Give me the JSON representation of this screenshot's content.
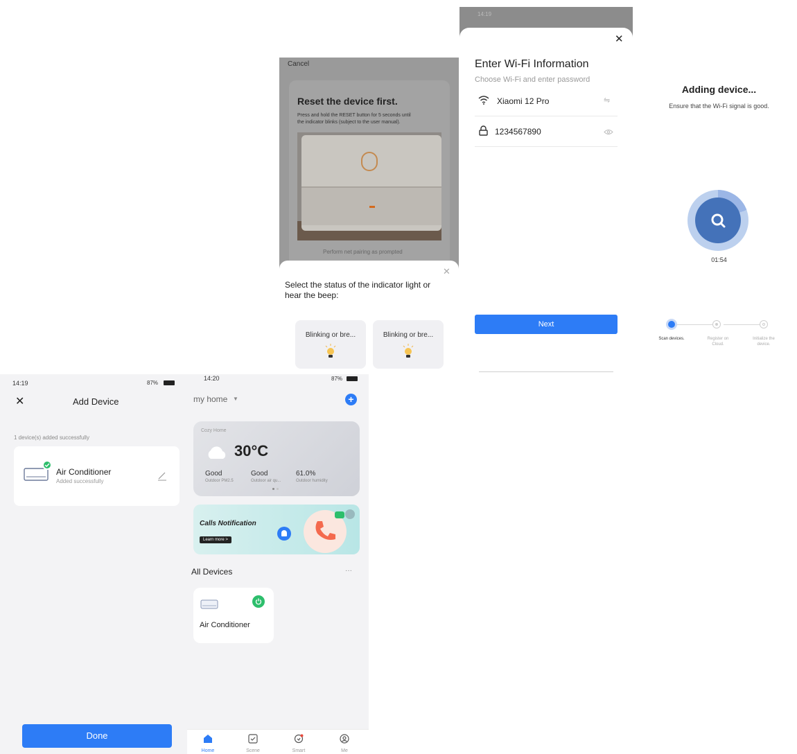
{
  "reset": {
    "cancel": "Cancel",
    "title": "Reset the device first.",
    "desc1": "Press and hold the RESET button for 5 seconds until",
    "desc2": "the indicator blinks (subject to the user manual).",
    "prompt_link": "Perform net pairing as prompted",
    "sheet_title1": "Select the status of the indicator light or",
    "sheet_title2": "hear the beep:",
    "options": [
      "Blinking or bre...",
      "Blinking or bre..."
    ]
  },
  "wifi": {
    "status_time": "14:19",
    "title": "Enter Wi-Fi Information",
    "subtitle": "Choose Wi-Fi and enter password",
    "ssid": "Xiaomi 12 Pro",
    "password": "1234567890",
    "next": "Next"
  },
  "adding": {
    "title": "Adding device...",
    "subtitle": "Ensure that the Wi-Fi signal is good.",
    "timer": "01:54",
    "steps": [
      {
        "label1": "Scan devices.",
        "label2": ""
      },
      {
        "label1": "Register on",
        "label2": "Cloud."
      },
      {
        "label1": "Initialize the",
        "label2": "device."
      }
    ]
  },
  "add_device": {
    "status_time": "14:19",
    "status_right": "87%",
    "title": "Add Device",
    "summary": "1 device(s) added successfully",
    "device_name": "Air Conditioner",
    "device_status": "Added successfully",
    "done": "Done"
  },
  "home": {
    "status_time": "14:20",
    "status_right": "87%",
    "home_name": "my home",
    "weather": {
      "label": "Cozy Home",
      "temp": "30°C",
      "metrics": [
        {
          "value": "Good",
          "label": "Outdoor PM2.5"
        },
        {
          "value": "Good",
          "label": "Outdoor air qu..."
        },
        {
          "value": "61.0%",
          "label": "Outdoor humidity"
        }
      ]
    },
    "promo": {
      "title": "Calls Notification",
      "button": "Learn more >"
    },
    "all_devices": "All Devices",
    "more": "···",
    "device_name": "Air Conditioner",
    "tabs": [
      "Home",
      "Scene",
      "Smart",
      "Me"
    ],
    "colors": {
      "accent": "#2d7cf6",
      "power": "#2dbe6c"
    }
  }
}
